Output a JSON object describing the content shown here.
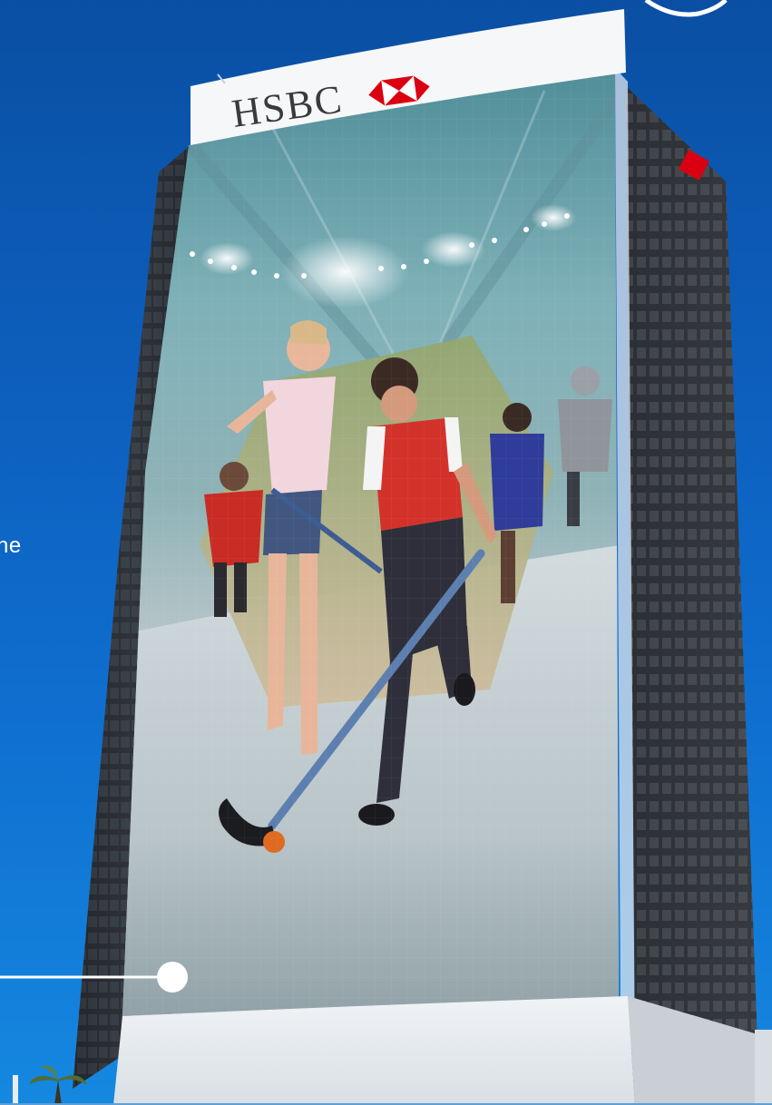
{
  "banner": {
    "brand_text": "HSBC",
    "brand_color": "#db0011"
  },
  "caption": {
    "partial_text": "ne"
  },
  "colors": {
    "sky_top": "#0a4fa3",
    "sky_bottom": "#1588e0",
    "tower_dark": "#2a2d33",
    "ice": "#c9d3d8"
  },
  "icons": {
    "brand_logo": "hexagon-logo-icon",
    "pointer": "callout-dot-icon"
  }
}
